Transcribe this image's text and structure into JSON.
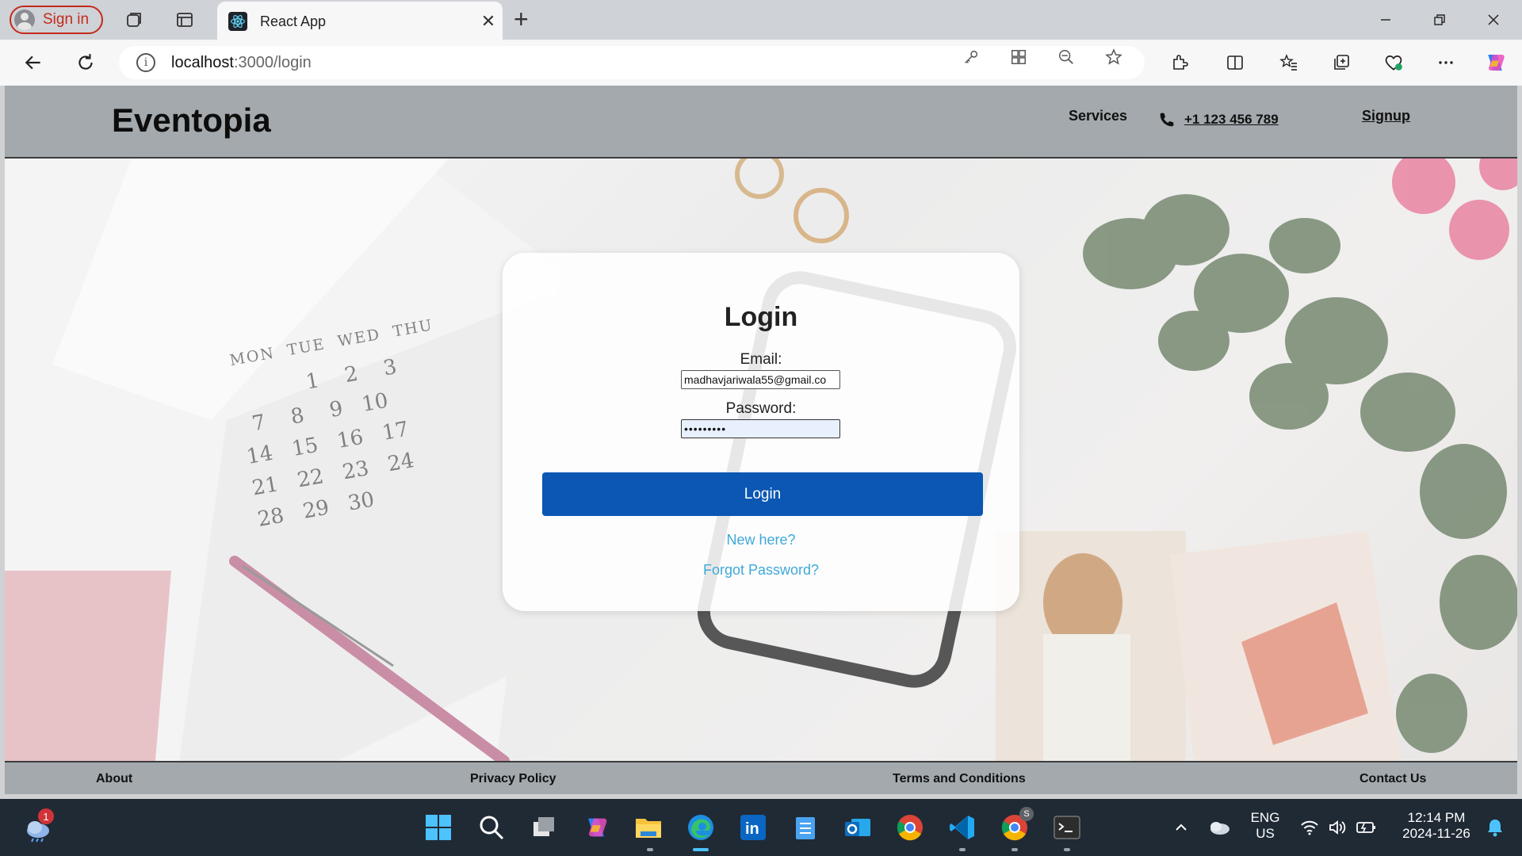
{
  "browser": {
    "signin_label": "Sign in",
    "tab_title": "React App",
    "url_host": "localhost",
    "url_path": ":3000/login"
  },
  "site": {
    "brand": "Eventopia",
    "nav": {
      "services": "Services",
      "phone": "+1 123 456 789",
      "signup": "Signup"
    },
    "login": {
      "title": "Login",
      "email_label": "Email:",
      "email_value": "madhavjariwala55@gmail.co",
      "password_label": "Password:",
      "password_value": "•••••••••",
      "button_label": "Login",
      "new_here": "New here?",
      "forgot_password": "Forgot Password?"
    },
    "footer": {
      "about": "About",
      "privacy": "Privacy Policy",
      "terms": "Terms and Conditions",
      "contact": "Contact Us"
    }
  },
  "taskbar": {
    "weather_badge": "1",
    "language_line1": "ENG",
    "language_line2": "US",
    "time": "12:14 PM",
    "date": "2024-11-26",
    "chrome_profile_badge": "S"
  },
  "colors": {
    "accent_button": "#0b57b3",
    "link": "#3fa9d9",
    "header_bg": "#a3a9ad",
    "signin_red": "#c42b1c"
  }
}
